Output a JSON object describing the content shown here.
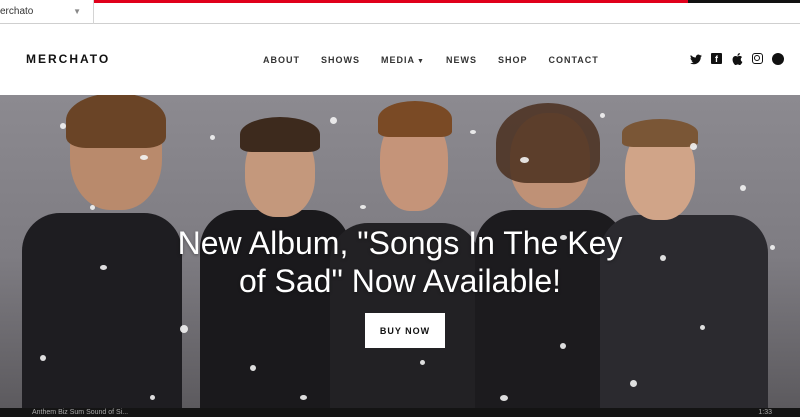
{
  "theme_switcher": {
    "value": "erchato"
  },
  "header": {
    "logo": "MERCHATO",
    "nav": [
      "ABOUT",
      "SHOWS",
      "MEDIA",
      "NEWS",
      "SHOP",
      "CONTACT"
    ],
    "social_icons": [
      "twitter-icon",
      "facebook-icon",
      "apple-icon",
      "instagram-icon",
      "spotify-icon"
    ]
  },
  "hero": {
    "title_line1": "New Album, \"Songs In The Key",
    "title_line2": "of Sad\" Now Available!",
    "button": "BUY NOW"
  },
  "footer_bar": {
    "left": "Anthem  Biz Sum  Sound of Si...",
    "right": "1:33"
  },
  "colors": {
    "accent_red": "#e0001b",
    "text_dark": "#111111",
    "hero_bg": "#7e7c82"
  }
}
